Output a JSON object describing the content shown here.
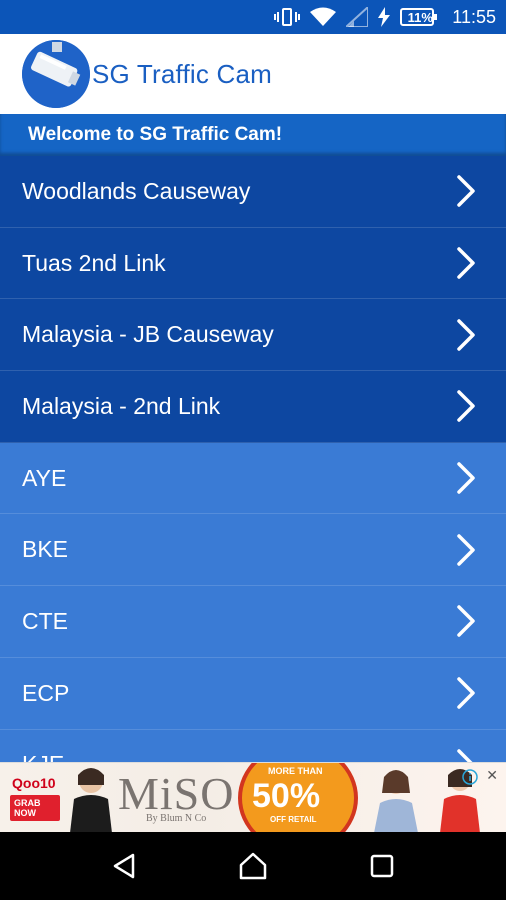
{
  "status_bar": {
    "time": "11:55",
    "battery": "11%",
    "icons": [
      "vibrate-icon",
      "wifi-icon",
      "signal-icon",
      "charging-icon",
      "battery-icon"
    ]
  },
  "app": {
    "title": "SG Traffic Cam",
    "logo_icon": "traffic-camera-icon"
  },
  "welcome": "Welcome to SG Traffic Cam!",
  "list": {
    "items": [
      {
        "label": "Woodlands Causeway",
        "style": "dark"
      },
      {
        "label": "Tuas 2nd Link",
        "style": "dark"
      },
      {
        "label": "Malaysia - JB Causeway",
        "style": "dark"
      },
      {
        "label": "Malaysia - 2nd Link",
        "style": "dark"
      },
      {
        "label": "AYE",
        "style": "light"
      },
      {
        "label": "BKE",
        "style": "light"
      },
      {
        "label": "CTE",
        "style": "light"
      },
      {
        "label": "ECP",
        "style": "light"
      },
      {
        "label": "KJE",
        "style": "light"
      }
    ],
    "chevron_icon": "chevron-right-icon"
  },
  "ad": {
    "brand": "Qoo10",
    "cta": "GRAB NOW",
    "headline": "MiSO",
    "sub": "By Blum N Co",
    "more_than": "MORE THAN",
    "percent": "50%",
    "off": "OFF RETAIL"
  },
  "nav_bar": {
    "back_icon": "back-icon",
    "home_icon": "home-icon",
    "recents_icon": "recents-icon"
  },
  "colors": {
    "status_bar": "#0c55b8",
    "accent": "#1a5fc2",
    "welcome_bg": "#1565c5",
    "row_dark": "#0d47a1",
    "row_light": "#3a7bd5"
  }
}
